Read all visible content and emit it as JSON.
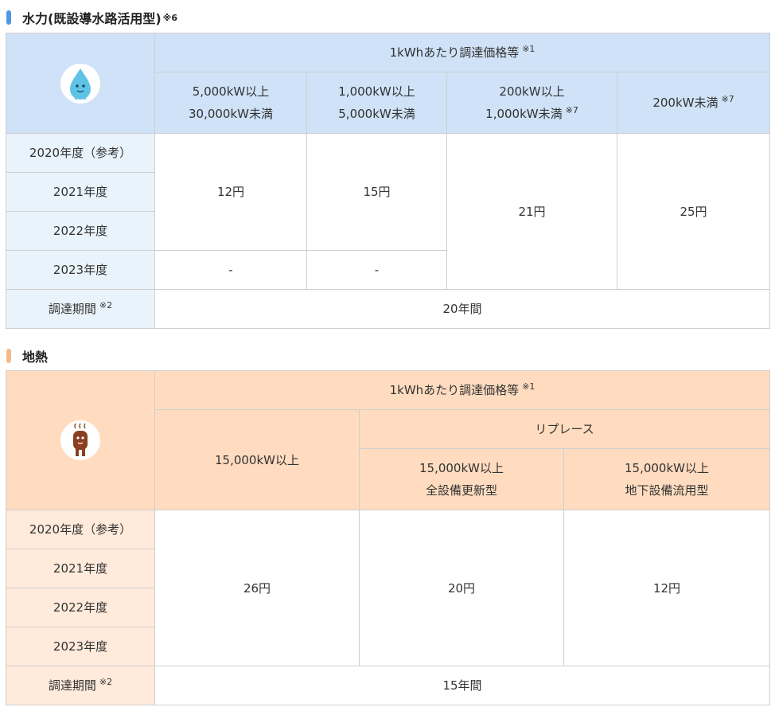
{
  "hydro": {
    "title": "水力(既設導水路活用型)",
    "title_note": "※6",
    "accent": "#4a9be0",
    "icon": "water-drop-mascot-icon",
    "price_header": "1kWhあたり調達価格等",
    "price_header_note": "※1",
    "columns": [
      {
        "line1": "5,000kW以上",
        "line2": "30,000kW未満",
        "note": ""
      },
      {
        "line1": "1,000kW以上",
        "line2": "5,000kW未満",
        "note": ""
      },
      {
        "line1": "200kW以上",
        "line2": "1,000kW未満",
        "note": "※7"
      },
      {
        "line1": "200kW未満",
        "line2": "",
        "note": "※7"
      }
    ],
    "years": [
      "2020年度（参考）",
      "2021年度",
      "2022年度",
      "2023年度"
    ],
    "prices": {
      "col1": "12円",
      "col2": "15円",
      "col1_2023": "-",
      "col2_2023": "-",
      "col3": "21円",
      "col4": "25円"
    },
    "period_label": "調達期間",
    "period_note": "※2",
    "period_value": "20年間"
  },
  "geo": {
    "title": "地熱",
    "accent": "#f5b98a",
    "icon": "hot-spring-mascot-icon",
    "price_header": "1kWhあたり調達価格等",
    "price_header_note": "※1",
    "col1": "15,000kW以上",
    "replace_header": "リプレース",
    "col2": {
      "line1": "15,000kW以上",
      "line2": "全設備更新型"
    },
    "col3": {
      "line1": "15,000kW以上",
      "line2": "地下設備流用型"
    },
    "years": [
      "2020年度（参考）",
      "2021年度",
      "2022年度",
      "2023年度"
    ],
    "prices": {
      "col1": "26円",
      "col2": "20円",
      "col3": "12円"
    },
    "period_label": "調達期間",
    "period_note": "※2",
    "period_value": "15年間"
  }
}
